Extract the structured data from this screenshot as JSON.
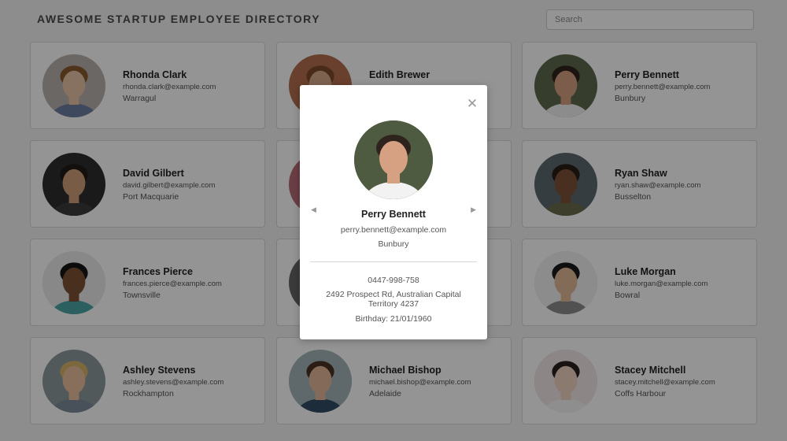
{
  "header": {
    "title": "AWESOME STARTUP EMPLOYEE DIRECTORY",
    "search_placeholder": "Search"
  },
  "employees": [
    {
      "name": "Rhonda Clark",
      "email": "rhonda.clark@example.com",
      "city": "Warragul",
      "skin": "#e9c3a6",
      "hair": "#8a5a2b",
      "bg": "#b9b2ae",
      "shirt": "#6d7fa3"
    },
    {
      "name": "Edith Brewer",
      "email": "",
      "city": "",
      "skin": "#d8a98a",
      "hair": "#7a4a2a",
      "bg": "#b66f4e",
      "shirt": "#d7c3b7"
    },
    {
      "name": "Perry Bennett",
      "email": "perry.bennett@example.com",
      "city": "Bunbury",
      "skin": "#d6a182",
      "hair": "#2f241d",
      "bg": "#5d6a4e",
      "shirt": "#f2f2f2"
    },
    {
      "name": "David Gilbert",
      "email": "david.gilbert@example.com",
      "city": "Port Macquarie",
      "skin": "#cf9f77",
      "hair": "#1f1a17",
      "bg": "#2d2d2d",
      "shirt": "#3c3c3c"
    },
    {
      "name": "",
      "email": "",
      "city": "",
      "skin": "#e0b7a0",
      "hair": "#6b4a31",
      "bg": "#b86c77",
      "shirt": "#ffffff"
    },
    {
      "name": "Ryan Shaw",
      "email": "ryan.shaw@example.com",
      "city": "Busselton",
      "skin": "#7d5238",
      "hair": "#2a1c14",
      "bg": "#5c6a70",
      "shirt": "#6b6b4c"
    },
    {
      "name": "Frances Pierce",
      "email": "frances.pierce@example.com",
      "city": "Townsville",
      "skin": "#7c5134",
      "hair": "#151515",
      "bg": "#eaeaea",
      "shirt": "#4da6a6"
    },
    {
      "name": "",
      "email": "",
      "city": "",
      "skin": "#b0806a",
      "hair": "#3d2b21",
      "bg": "#666666",
      "shirt": "#444444"
    },
    {
      "name": "Luke Morgan",
      "email": "luke.morgan@example.com",
      "city": "Bowral",
      "skin": "#e0b896",
      "hair": "#1b1b1b",
      "bg": "#f1f1f1",
      "shirt": "#8c8c8c"
    },
    {
      "name": "Ashley Stevens",
      "email": "ashley.stevens@example.com",
      "city": "Rockhampton",
      "skin": "#e8c09d",
      "hair": "#d8b36a",
      "bg": "#8e9a9e",
      "shirt": "#7c8b9a"
    },
    {
      "name": "Michael Bishop",
      "email": "michael.bishop@example.com",
      "city": "Adelaide",
      "skin": "#e4b899",
      "hair": "#4a3222",
      "bg": "#a4b6b8",
      "shirt": "#334c66"
    },
    {
      "name": "Stacey Mitchell",
      "email": "stacey.mitchell@example.com",
      "city": "Coffs Harbour",
      "skin": "#eed2c0",
      "hair": "#2a2020",
      "bg": "#f3e7e8",
      "shirt": "#f5f5f5"
    }
  ],
  "modal": {
    "name": "Perry Bennett",
    "email": "perry.bennett@example.com",
    "city": "Bunbury",
    "phone": "0447-998-758",
    "address": "2492 Prospect Rd, Australian Capital Territory 4237",
    "birthday": "Birthday: 21/01/1960",
    "skin": "#d6a182",
    "hair": "#2f241d",
    "bg": "#4f5b40",
    "shirt": "#f2f2f2",
    "close_icon": "close-icon",
    "prev_icon": "triangle-left-icon",
    "next_icon": "triangle-right-icon"
  },
  "colors": {
    "page_bg": "#f3f3f3",
    "card_border": "#d9d9d9",
    "overlay": "rgba(0,0,0,0.42)"
  }
}
